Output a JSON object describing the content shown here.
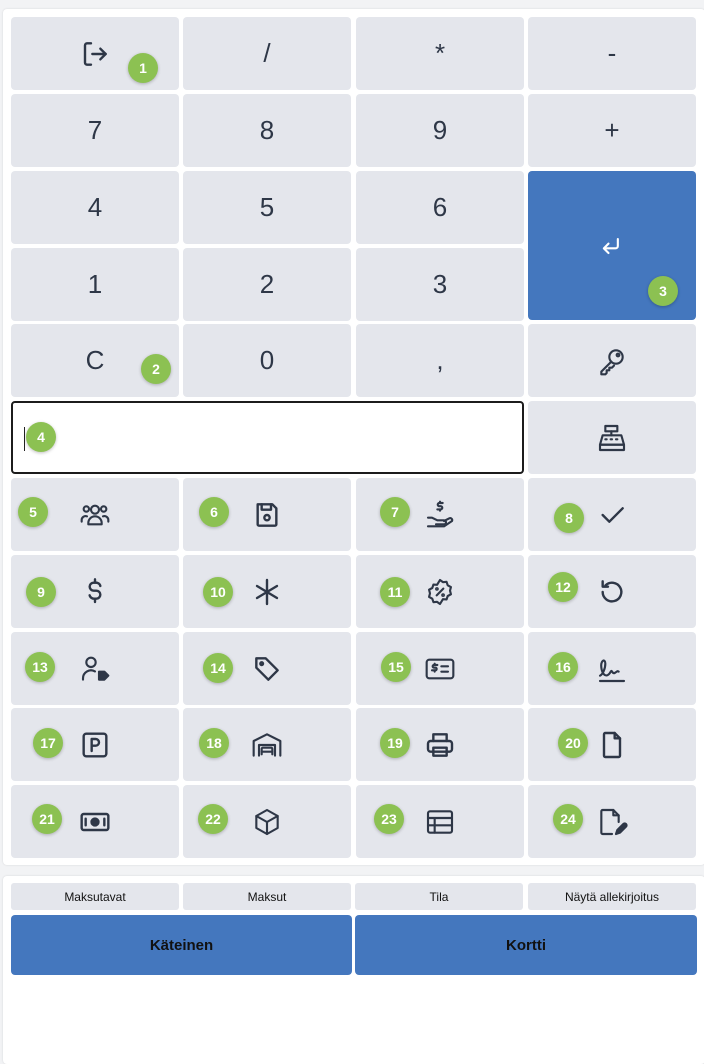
{
  "keypad": {
    "divide": "/",
    "multiply": "*",
    "minus": "-",
    "plus": "+",
    "comma": ",",
    "clear": "C",
    "digits": {
      "d0": "0",
      "d1": "1",
      "d2": "2",
      "d3": "3",
      "d4": "4",
      "d5": "5",
      "d6": "6",
      "d7": "7",
      "d8": "8",
      "d9": "9"
    }
  },
  "input": {
    "value": ""
  },
  "badges": [
    "1",
    "2",
    "3",
    "4",
    "5",
    "6",
    "7",
    "8",
    "9",
    "10",
    "11",
    "12",
    "13",
    "14",
    "15",
    "16",
    "17",
    "18",
    "19",
    "20",
    "21",
    "22",
    "23",
    "24"
  ],
  "tabs": [
    "Maksutavat",
    "Maksut",
    "Tila",
    "Näytä allekirjoitus"
  ],
  "payment": {
    "cash": "Käteinen",
    "card": "Kortti"
  },
  "colors": {
    "accent": "#4477be",
    "key": "#e4e6ec",
    "badge": "#8cc152",
    "text": "#2e3747"
  }
}
